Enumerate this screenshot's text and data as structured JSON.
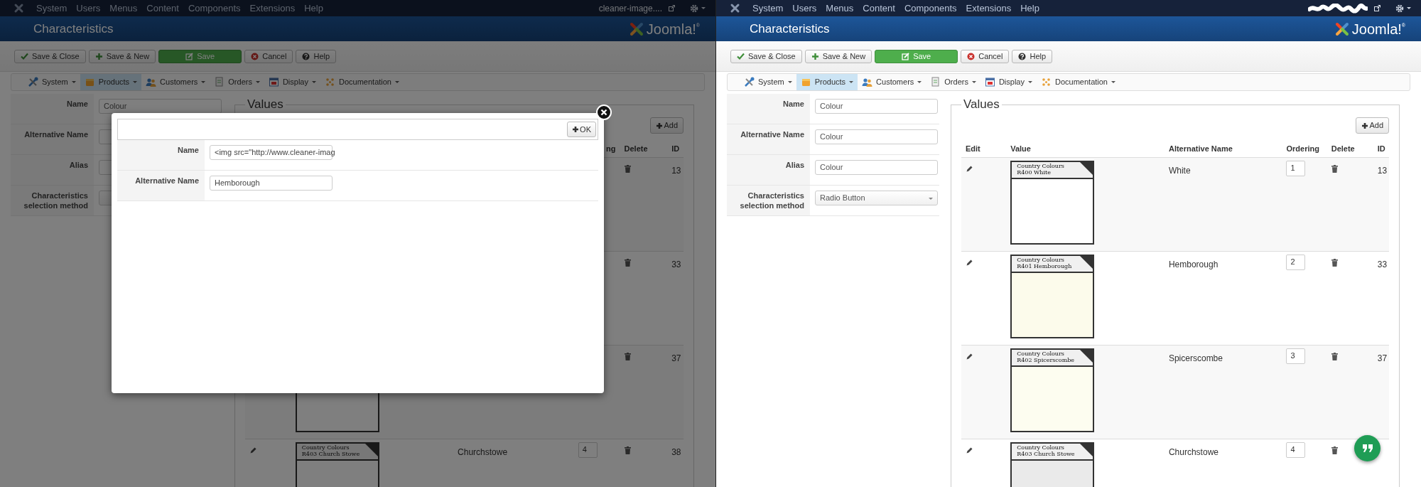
{
  "panels": [
    {
      "dimmed": true,
      "navbar": {
        "items": [
          "System",
          "Users",
          "Menus",
          "Content",
          "Components",
          "Extensions",
          "Help"
        ],
        "account": {
          "kind": "text",
          "label": "cleaner-image...."
        }
      },
      "title": "Characteristics",
      "logo": "Joomla!$^{®}$",
      "toolbar": [
        {
          "kind": "save-close",
          "label": "Save & Close"
        },
        {
          "kind": "save-new",
          "label": "Save & New"
        },
        {
          "kind": "save",
          "label": "Save"
        },
        {
          "kind": "cancel",
          "label": "Cancel"
        },
        {
          "kind": "help",
          "label": "Help"
        }
      ],
      "submenu": [
        {
          "kind": "system",
          "label": "System",
          "selected": false
        },
        {
          "kind": "products",
          "label": "Products",
          "selected": true
        },
        {
          "kind": "customers",
          "label": "Customers",
          "selected": false
        },
        {
          "kind": "orders",
          "label": "Orders",
          "selected": false
        },
        {
          "kind": "display",
          "label": "Display",
          "selected": false
        },
        {
          "kind": "documentation",
          "label": "Documentation",
          "selected": false
        }
      ],
      "form": [
        {
          "label": "Name",
          "kind": "text",
          "value": "Colour"
        },
        {
          "label": "Alternative Name",
          "kind": "text"
        },
        {
          "label": "Alias",
          "kind": "text"
        },
        {
          "label": "Characteristics selection method",
          "kind": "select"
        }
      ],
      "values": {
        "legend": "Values",
        "add": "Add",
        "columns": [
          {
            "kind": "ordering",
            "label": "ng",
            "cut": true
          },
          {
            "kind": "delete",
            "label": "Delete"
          },
          {
            "kind": "id",
            "label": "ID"
          }
        ],
        "rows": [
          {
            "delete": true,
            "id": "13"
          },
          {
            "delete": true,
            "id": "33"
          },
          {
            "swatch": {
              "kind": "plain"
            },
            "delete": true,
            "id": "37"
          },
          {
            "edit": true,
            "swatch": {
              "kind": "labelled",
              "lines": [
                "Country Colours",
                "R403 Church Stowe"
              ]
            },
            "alt_name": "Churchstowe",
            "ordering": "4",
            "delete": true,
            "id": "38"
          }
        ]
      },
      "modal": {
        "ok": "OK",
        "fields": [
          {
            "label": "Name",
            "value": "<img src=\"http://www.cleaner-imag"
          },
          {
            "label": "Alternative Name",
            "value": "Hemborough"
          }
        ]
      }
    },
    {
      "dimmed": false,
      "navbar": {
        "items": [
          "System",
          "Users",
          "Menus",
          "Content",
          "Components",
          "Extensions",
          "Help"
        ],
        "account": {
          "kind": "redacted"
        }
      },
      "title": "Characteristics",
      "logo": "Joomla!$^{®}$",
      "toolbar": [
        {
          "kind": "save-close",
          "label": "Save & Close"
        },
        {
          "kind": "save-new",
          "label": "Save & New"
        },
        {
          "kind": "save",
          "label": "Save"
        },
        {
          "kind": "cancel",
          "label": "Cancel"
        },
        {
          "kind": "help",
          "label": "Help"
        }
      ],
      "submenu": [
        {
          "kind": "system",
          "label": "System",
          "selected": false
        },
        {
          "kind": "products",
          "label": "Products",
          "selected": true
        },
        {
          "kind": "customers",
          "label": "Customers",
          "selected": false
        },
        {
          "kind": "orders",
          "label": "Orders",
          "selected": false
        },
        {
          "kind": "display",
          "label": "Display",
          "selected": false
        },
        {
          "kind": "documentation",
          "label": "Documentation",
          "selected": false
        }
      ],
      "form": [
        {
          "label": "Name",
          "kind": "text",
          "value": "Colour"
        },
        {
          "label": "Alternative Name",
          "kind": "text",
          "value": "Colour"
        },
        {
          "label": "Alias",
          "kind": "text",
          "value": "Colour"
        },
        {
          "label": "Characteristics selection method",
          "kind": "select",
          "value": "Radio Button"
        }
      ],
      "values": {
        "legend": "Values",
        "add": "Add",
        "columns": [
          {
            "kind": "edit",
            "label": "Edit"
          },
          {
            "kind": "value",
            "label": "Value"
          },
          {
            "kind": "alternative_name",
            "label": "Alternative Name"
          },
          {
            "kind": "ordering",
            "label": "Ordering"
          },
          {
            "kind": "delete",
            "label": "Delete"
          },
          {
            "kind": "id",
            "label": "ID"
          }
        ],
        "rows": [
          {
            "edit": true,
            "swatch": {
              "kind": "labelled",
              "color": "#ffffff",
              "lines": [
                "Country Colours",
                "R400 White"
              ]
            },
            "alt_name": "White",
            "ordering": "1",
            "delete": true,
            "id": "13"
          },
          {
            "edit": true,
            "swatch": {
              "kind": "labelled",
              "color": "#fcfbeb",
              "lines": [
                "Country Colours",
                "R401 Hemborough"
              ]
            },
            "alt_name": "Hemborough",
            "ordering": "2",
            "delete": true,
            "id": "33"
          },
          {
            "edit": true,
            "swatch": {
              "kind": "labelled",
              "color": "#fdfdf0",
              "lines": [
                "Country Colours",
                "R402 Spicerscombe"
              ]
            },
            "alt_name": "Spicerscombe",
            "ordering": "3",
            "delete": true,
            "id": "37"
          },
          {
            "edit": true,
            "swatch": {
              "kind": "labelled",
              "color": "#eaeaea",
              "lines": [
                "Country Colours",
                "R403 Church Stowe"
              ]
            },
            "alt_name": "Churchstowe",
            "ordering": "4",
            "delete": true
          }
        ]
      },
      "chat_button": true
    }
  ]
}
